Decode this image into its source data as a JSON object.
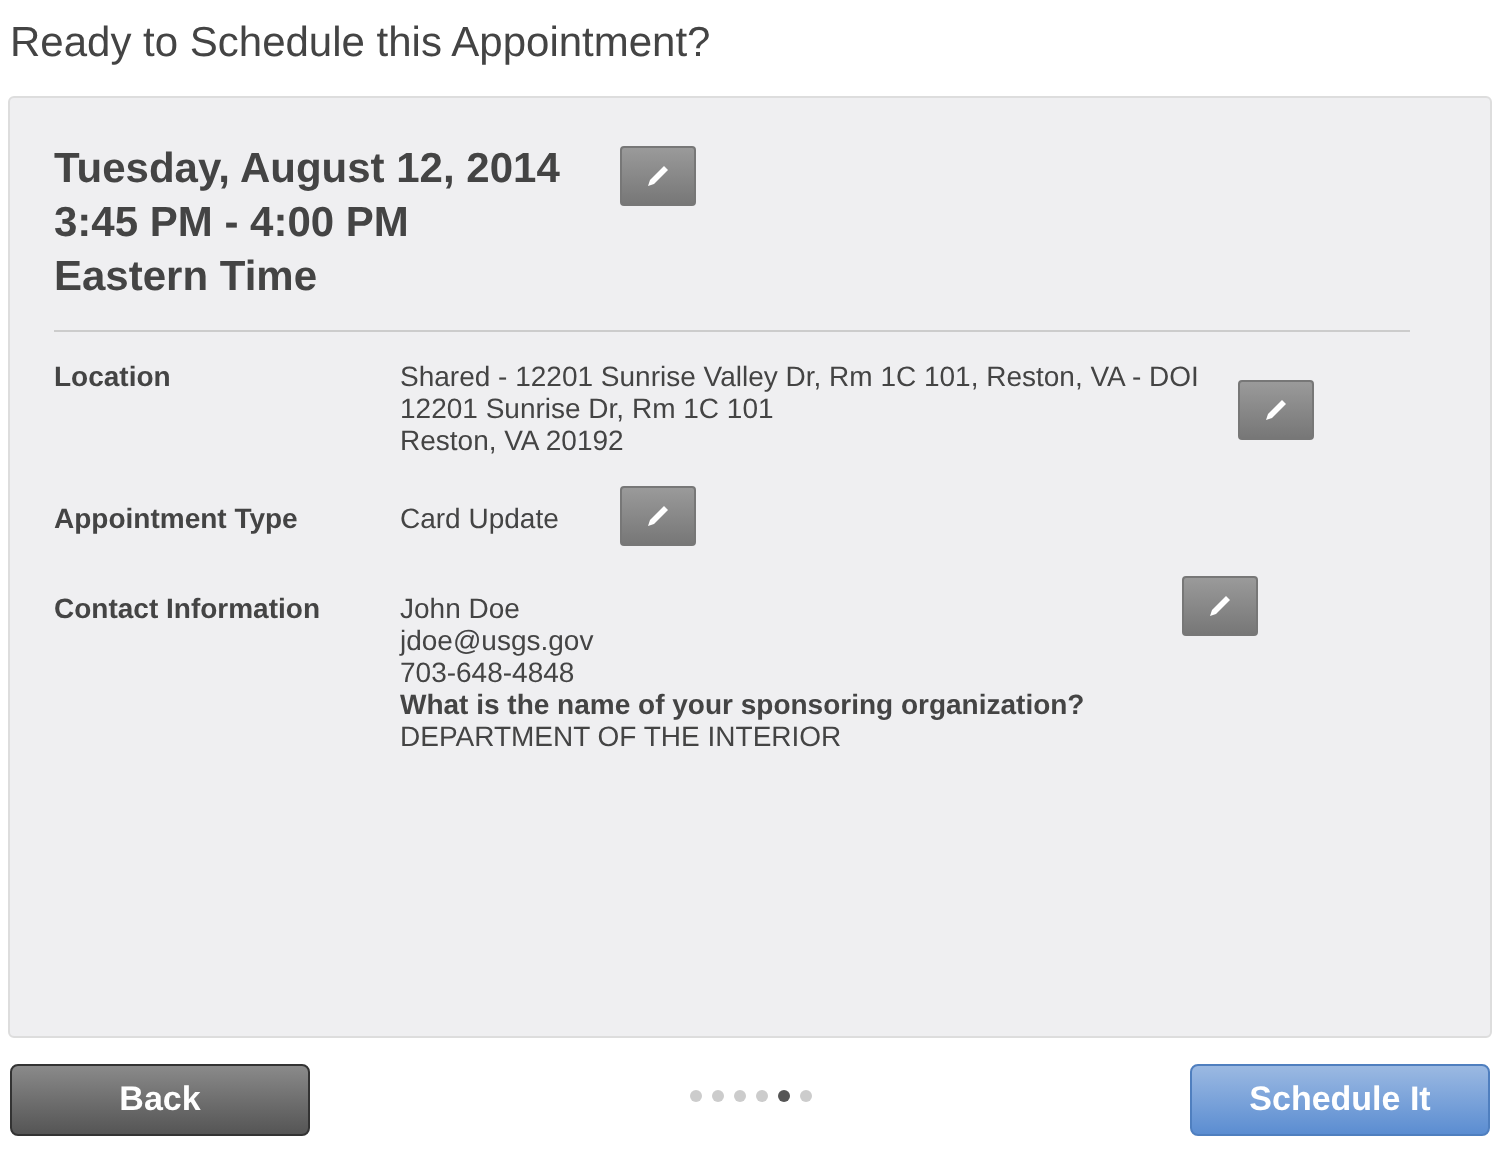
{
  "title": "Ready to Schedule this Appointment?",
  "when": {
    "date": "Tuesday, August 12, 2014",
    "time": "3:45 PM - 4:00 PM",
    "zone": "Eastern Time"
  },
  "details": [
    {
      "label": "Location",
      "lines": [
        "Shared - 12201 Sunrise Valley Dr, Rm 1C 101, Reston, VA - DOI",
        "12201 Sunrise Dr, Rm 1C 101",
        "Reston, VA 20192"
      ]
    },
    {
      "label": "Appointment Type",
      "lines": [
        "Card Update"
      ]
    },
    {
      "label": "Contact Information",
      "lines": [
        "John Doe",
        "jdoe@usgs.gov",
        "703-648-4848"
      ],
      "question": "What is the name of your sponsoring organization?",
      "answer": "DEPARTMENT OF THE INTERIOR"
    }
  ],
  "pager": [
    {
      "selected": false
    },
    {
      "selected": false
    },
    {
      "selected": false
    },
    {
      "selected": false
    },
    {
      "selected": true
    },
    {
      "selected": false
    }
  ],
  "buttons": {
    "back": "Back",
    "next": "Schedule It"
  }
}
